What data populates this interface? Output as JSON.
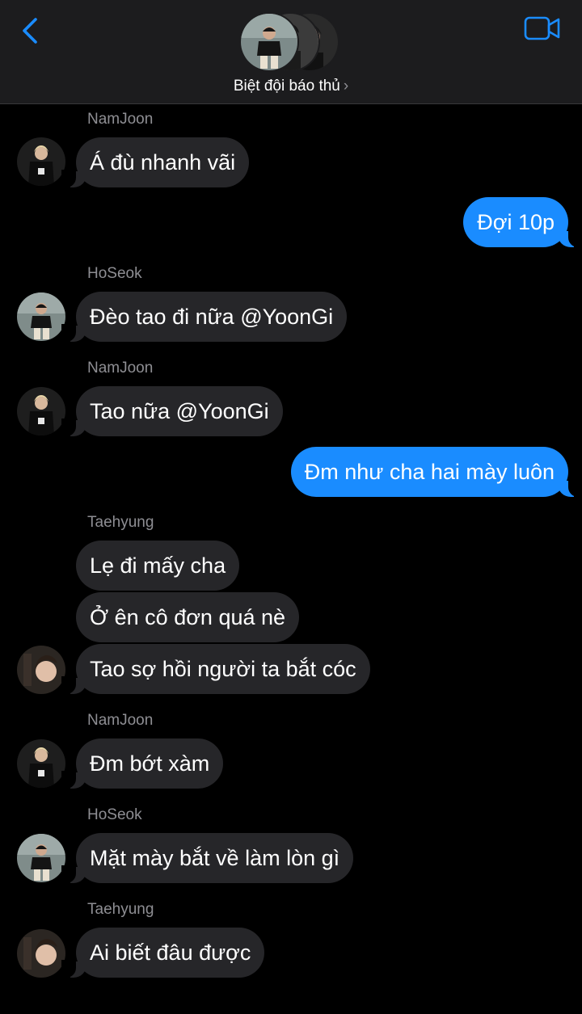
{
  "header": {
    "group_name": "Biệt đội báo thủ",
    "chevron": "›",
    "back_icon": "chevron-left-icon",
    "video_icon": "video-camera-icon",
    "accent_color": "#1a8cff"
  },
  "messages": [
    {
      "sender": "NamJoon",
      "text": "Á đù nhanh vãi"
    },
    {
      "text": "Đợi 10p"
    },
    {
      "sender": "HoSeok",
      "text": "Đèo tao đi nữa @YoonGi"
    },
    {
      "sender": "NamJoon",
      "text": "Tao nữa @YoonGi"
    },
    {
      "text": "Đm như cha hai mày luôn"
    },
    {
      "sender": "Taehyung",
      "text": "Lẹ đi mấy cha"
    },
    {
      "text": "Ở ên cô đơn quá nè"
    },
    {
      "text": "Tao sợ hồi người ta bắt cóc"
    },
    {
      "sender": "NamJoon",
      "text": "Đm bớt xàm"
    },
    {
      "sender": "HoSeok",
      "text": "Mặt mày bắt về làm lòn gì"
    },
    {
      "sender": "Taehyung",
      "text": "Ai biết đâu được"
    }
  ]
}
